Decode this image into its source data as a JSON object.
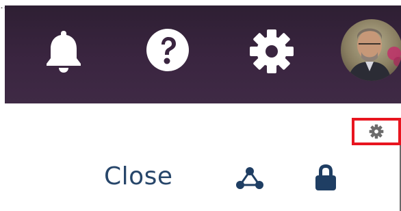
{
  "top_clip": {
    "text": "... ... ... ..."
  },
  "header": {
    "background_color": "#3a2540",
    "icons": {
      "notifications": "bell-icon",
      "help": "help-icon",
      "settings": "gear-icon"
    },
    "avatar": {
      "icon": "user-avatar"
    }
  },
  "panel": {
    "settings_icon": "gear-icon",
    "highlight_color": "#e8151f",
    "close_label": "Close",
    "close_color": "#27466a",
    "share_icon": "share-network-icon",
    "lock_icon": "lock-icon"
  }
}
